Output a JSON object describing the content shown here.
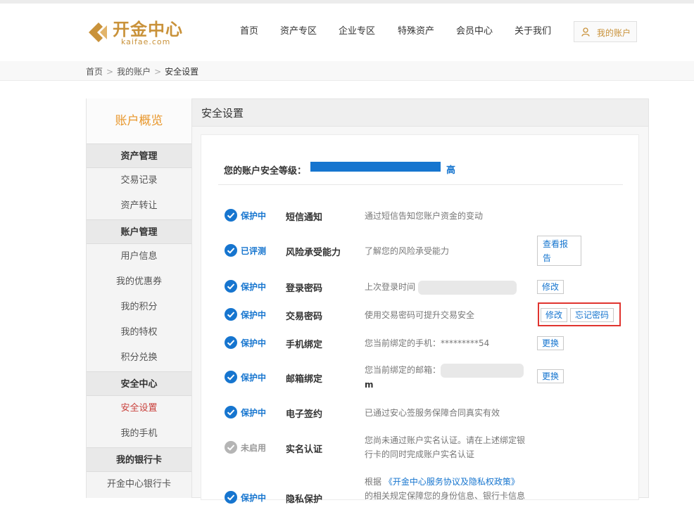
{
  "logo": {
    "cn": "开金中心",
    "en": "kaifae.com"
  },
  "nav": [
    "首页",
    "资产专区",
    "企业专区",
    "特殊资产",
    "会员中心",
    "关于我们"
  ],
  "account_button": "我的账户",
  "breadcrumb": {
    "home": "首页",
    "account": "我的账户",
    "current": "安全设置",
    "sep": ">"
  },
  "sidebar": {
    "title": "账户概览",
    "groups": [
      {
        "label": "资产管理",
        "items": [
          "交易记录",
          "资产转让"
        ]
      },
      {
        "label": "账户管理",
        "items": [
          "用户信息",
          "我的优惠券",
          "我的积分",
          "我的特权",
          "积分兑换"
        ]
      },
      {
        "label": "安全中心",
        "items": [
          "安全设置",
          "我的手机"
        ]
      },
      {
        "label": "我的银行卡",
        "items": [
          "开金中心银行卡"
        ]
      }
    ],
    "active_item": "安全设置"
  },
  "main": {
    "title": "安全设置",
    "level_label": "您的账户安全等级：",
    "level_value": "高",
    "level_progress": 1.0,
    "rows": [
      {
        "status": "保护中",
        "status_type": "ok",
        "name": "短信通知",
        "desc": "通过短信告知您账户资金的变动"
      },
      {
        "status": "已评测",
        "status_type": "ok",
        "name": "风险承受能力",
        "desc": "了解您的风险承受能力",
        "button": "查看报告"
      },
      {
        "status": "保护中",
        "status_type": "ok",
        "name": "登录密码",
        "desc": "上次登录时间",
        "button": "修改"
      },
      {
        "status": "保护中",
        "status_type": "ok",
        "name": "交易密码",
        "desc": "使用交易密码可提升交易安全",
        "button": "修改",
        "button2": "忘记密码"
      },
      {
        "status": "保护中",
        "status_type": "ok",
        "name": "手机绑定",
        "desc": "您当前绑定的手机：*********54",
        "button": "更换"
      },
      {
        "status": "保护中",
        "status_type": "ok",
        "name": "邮箱绑定",
        "desc": "您当前绑定的邮箱：",
        "desc2": "m",
        "button": "更换"
      },
      {
        "status": "保护中",
        "status_type": "ok",
        "name": "电子签约",
        "desc": "已通过安心签服务保障合同真实有效"
      },
      {
        "status": "未启用",
        "status_type": "off",
        "name": "实名认证",
        "desc": "您尚未通过账户实名认证。请在上述绑定银",
        "desc2": "行卡的同时完成账户实名认证"
      },
      {
        "status": "保护中",
        "status_type": "ok",
        "name": "隐私保护",
        "desc_prefix": "根据",
        "desc_link": "《开金中心服务协议及隐私权政策》",
        "desc2": "的相关规定保障您的身份信息、银行卡信息"
      }
    ]
  },
  "colors": {
    "accent": "#c9923a",
    "blue": "#1675cf",
    "red": "#e0342f",
    "active_side": "#c9413c"
  }
}
